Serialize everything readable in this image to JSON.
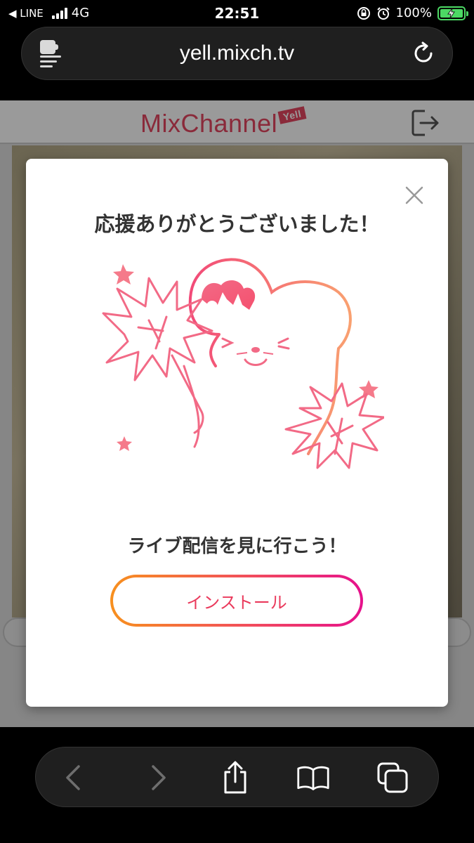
{
  "status_bar": {
    "back_app": "◀ LINE",
    "network": "4G",
    "time": "22:51",
    "battery_percent": "100%",
    "battery_level": 1.0,
    "battery_color": "#4cd964",
    "icons": [
      "signal-bars-icon",
      "orientation-lock-icon",
      "alarm-icon",
      "battery-charging-icon"
    ]
  },
  "browser": {
    "url": "yell.mixch.tv",
    "icons": [
      "page-settings-icon",
      "reload-icon"
    ]
  },
  "site": {
    "logo_text": "MixChannel",
    "logo_badge": "Yell",
    "brand_color": "#e8294f",
    "icons": [
      "logout-icon"
    ]
  },
  "modal": {
    "title": "応援ありがとうございました！",
    "subtitle": "ライブ配信を見に行こう！",
    "install_label": "インストール",
    "accent_gradient": [
      "#f7901e",
      "#f24d5c",
      "#e6118c"
    ],
    "icons": [
      "close-icon",
      "cheering-mouse-mascot-illustration"
    ]
  },
  "toolbar": {
    "icons": [
      "back-arrow-icon",
      "forward-arrow-icon",
      "share-icon",
      "bookmarks-icon",
      "tabs-icon"
    ]
  }
}
